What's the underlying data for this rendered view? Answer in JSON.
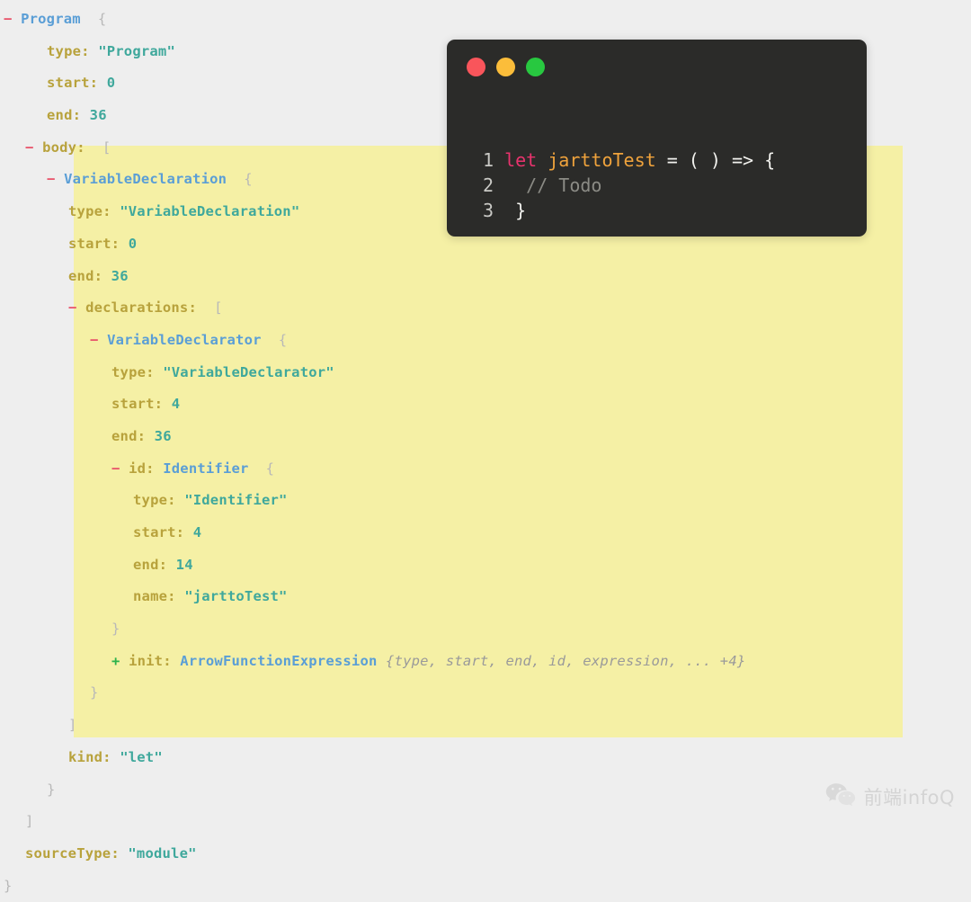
{
  "background_color": "#eeeeee",
  "highlight_color": "#f5f0a5",
  "colors": {
    "toggle_minus": "#e8536a",
    "toggle_plus": "#2bb24c",
    "node_type": "#5a9ed6",
    "key": "#b8a23c",
    "string": "#3fa89c",
    "number": "#3fa89c",
    "punctuation": "#b8b8b8",
    "preview": "#9a9a9a",
    "code_bg": "#2b2b29",
    "code_keyword": "#e8336d",
    "code_function": "#f0a33c",
    "code_plain": "#f2f2ee",
    "code_comment": "#8b8b85",
    "dot_red": "#f9555b",
    "dot_yellow": "#fbbd3a",
    "dot_green": "#28c840"
  },
  "ast_tree": {
    "lines": [
      {
        "indent": 0,
        "toggle": "-",
        "node": "Program",
        "punct_after": "{"
      },
      {
        "indent": 2,
        "key": "type",
        "string": "\"Program\""
      },
      {
        "indent": 2,
        "key": "start",
        "number": "0"
      },
      {
        "indent": 2,
        "key": "end",
        "number": "36"
      },
      {
        "indent": 1,
        "toggle": "-",
        "key": "body",
        "punct_after": "["
      },
      {
        "indent": 2,
        "toggle": "-",
        "node": "VariableDeclaration",
        "punct_after": "{"
      },
      {
        "indent": 3,
        "key": "type",
        "string": "\"VariableDeclaration\""
      },
      {
        "indent": 3,
        "key": "start",
        "number": "0"
      },
      {
        "indent": 3,
        "key": "end",
        "number": "36"
      },
      {
        "indent": 3,
        "toggle": "-",
        "key": "declarations",
        "punct_after": "["
      },
      {
        "indent": 4,
        "toggle": "-",
        "node": "VariableDeclarator",
        "punct_after": "{"
      },
      {
        "indent": 5,
        "key": "type",
        "string": "\"VariableDeclarator\""
      },
      {
        "indent": 5,
        "key": "start",
        "number": "4"
      },
      {
        "indent": 5,
        "key": "end",
        "number": "36"
      },
      {
        "indent": 5,
        "toggle": "-",
        "key": "id",
        "node": "Identifier",
        "punct_after": "{"
      },
      {
        "indent": 6,
        "key": "type",
        "string": "\"Identifier\""
      },
      {
        "indent": 6,
        "key": "start",
        "number": "4"
      },
      {
        "indent": 6,
        "key": "end",
        "number": "14"
      },
      {
        "indent": 6,
        "key": "name",
        "string": "\"jarttoTest\""
      },
      {
        "indent": 5,
        "close": "}"
      },
      {
        "indent": 5,
        "toggle": "+",
        "key": "init",
        "node": "ArrowFunctionExpression",
        "preview": "{type, start, end, id, expression, ... +4}"
      },
      {
        "indent": 4,
        "close": "}"
      },
      {
        "indent": 3,
        "close": "]"
      },
      {
        "indent": 3,
        "key": "kind",
        "string": "\"let\""
      },
      {
        "indent": 2,
        "close": "}"
      },
      {
        "indent": 1,
        "close": "]"
      },
      {
        "indent": 1,
        "key": "sourceType",
        "string": "\"module\""
      },
      {
        "indent": 0,
        "close": "}"
      }
    ]
  },
  "code_card": {
    "window_controls": [
      {
        "name": "close",
        "color": "#f9555b"
      },
      {
        "name": "minimize",
        "color": "#fbbd3a"
      },
      {
        "name": "maximize",
        "color": "#28c840"
      }
    ],
    "lines": [
      {
        "number": "1",
        "tokens": [
          {
            "text": "let",
            "type": "keyword"
          },
          {
            "text": " jarttoTest",
            "type": "function"
          },
          {
            "text": " = ( ) => {",
            "type": "plain"
          }
        ]
      },
      {
        "number": "2",
        "tokens": [
          {
            "text": "  // Todo",
            "type": "comment"
          }
        ]
      },
      {
        "number": "3",
        "tokens": [
          {
            "text": " }",
            "type": "plain"
          }
        ]
      }
    ]
  },
  "watermark": {
    "icon": "wechat-icon",
    "text": "前端infoQ"
  }
}
